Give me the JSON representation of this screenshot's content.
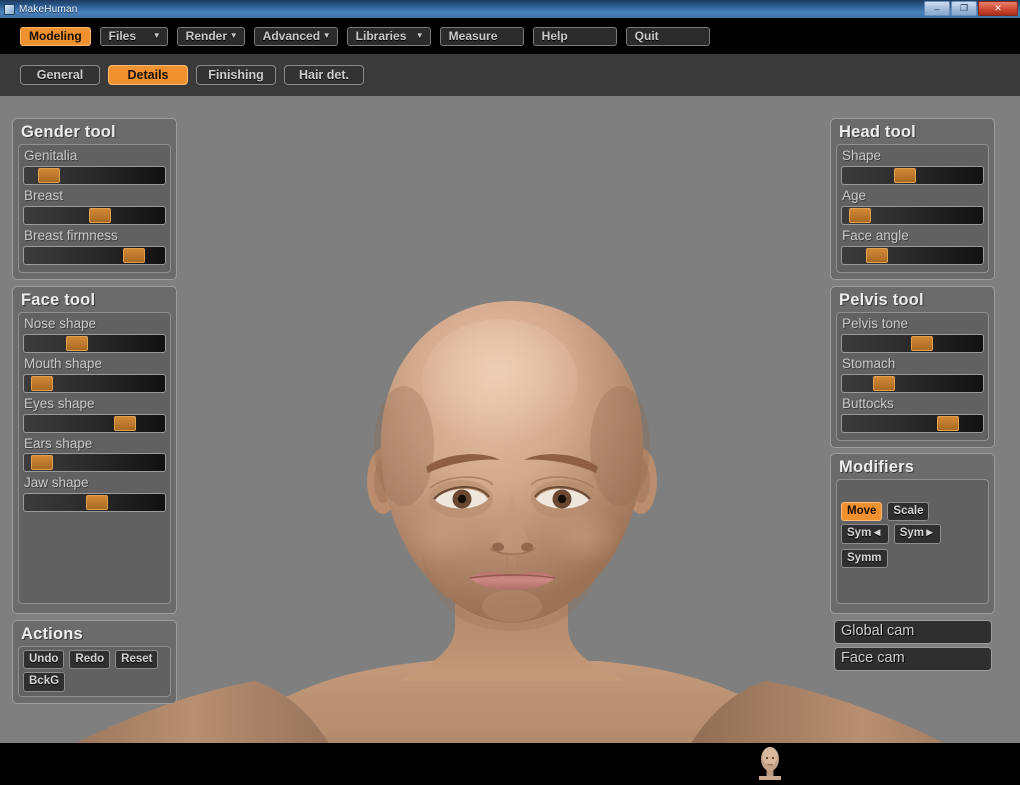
{
  "window": {
    "title": "MakeHuman",
    "subtitle": "",
    "icon": "app-icon",
    "controls": [
      {
        "name": "minimize-button",
        "glyph": "–"
      },
      {
        "name": "maximize-button",
        "glyph": "❐"
      },
      {
        "name": "close-button",
        "glyph": "✕"
      }
    ]
  },
  "menubar": {
    "items": [
      {
        "label": "Modeling",
        "active": true,
        "caret": false
      },
      {
        "label": "Files",
        "active": false,
        "caret": true
      },
      {
        "label": "Render",
        "active": false,
        "caret": true
      },
      {
        "label": "Advanced",
        "active": false,
        "caret": true
      },
      {
        "label": "Libraries",
        "active": false,
        "caret": true
      },
      {
        "label": "Measure",
        "active": false,
        "caret": false
      },
      {
        "label": "Help",
        "active": false,
        "caret": false
      },
      {
        "label": "Quit",
        "active": false,
        "caret": false
      }
    ]
  },
  "tabbar": {
    "items": [
      {
        "label": "General",
        "active": false
      },
      {
        "label": "Details",
        "active": true
      },
      {
        "label": "Finishing",
        "active": false
      },
      {
        "label": "Hair det.",
        "active": false
      }
    ]
  },
  "left_panels": {
    "gender_tool": {
      "title": "Gender tool",
      "sliders": [
        {
          "label": "Genitalia",
          "value": 12
        },
        {
          "label": "Breast",
          "value": 55
        },
        {
          "label": "Breast firmness",
          "value": 83
        }
      ]
    },
    "face_tool": {
      "title": "Face tool",
      "sliders": [
        {
          "label": "Nose shape",
          "value": 35
        },
        {
          "label": "Mouth shape",
          "value": 6
        },
        {
          "label": "Eyes shape",
          "value": 76
        },
        {
          "label": "Ears shape",
          "value": 6
        },
        {
          "label": "Jaw shape",
          "value": 52
        }
      ]
    },
    "actions": {
      "title": "Actions",
      "buttons": [
        {
          "label": "Undo"
        },
        {
          "label": "Redo"
        },
        {
          "label": "Reset"
        },
        {
          "label": "BckG"
        }
      ]
    }
  },
  "right_panels": {
    "head_tool": {
      "title": "Head tool",
      "sliders": [
        {
          "label": "Shape",
          "value": 44
        },
        {
          "label": "Age",
          "value": 6
        },
        {
          "label": "Face angle",
          "value": 20
        }
      ]
    },
    "pelvis_tool": {
      "title": "Pelvis tool",
      "sliders": [
        {
          "label": "Pelvis tone",
          "value": 58
        },
        {
          "label": "Stomach",
          "value": 26
        },
        {
          "label": "Buttocks",
          "value": 80
        }
      ]
    },
    "modifiers": {
      "title": "Modifiers",
      "buttons_row1": [
        {
          "label": "Move",
          "active": true
        },
        {
          "label": "Scale",
          "active": false
        }
      ],
      "buttons_row2": [
        {
          "label": "Sym◄",
          "active": false
        },
        {
          "label": "Sym►",
          "active": false
        },
        {
          "label": "Symm",
          "active": false
        }
      ]
    },
    "cameras": [
      {
        "label": "Global cam"
      },
      {
        "label": "Face cam"
      }
    ]
  },
  "viewport": {
    "background_color": "#7f7f7f",
    "bottom_bar_color": "#000000",
    "model_thumbnail": "head-thumbnail",
    "model": "female-head-and-torso"
  },
  "colors": {
    "accent": "#f0912f",
    "panel_bg": "#6b6b6b",
    "panel_inner_bg": "#616161",
    "menu_bg": "#000000",
    "tabbar_bg": "#3a3a3a",
    "viewport_bg": "#7f7f7f"
  }
}
